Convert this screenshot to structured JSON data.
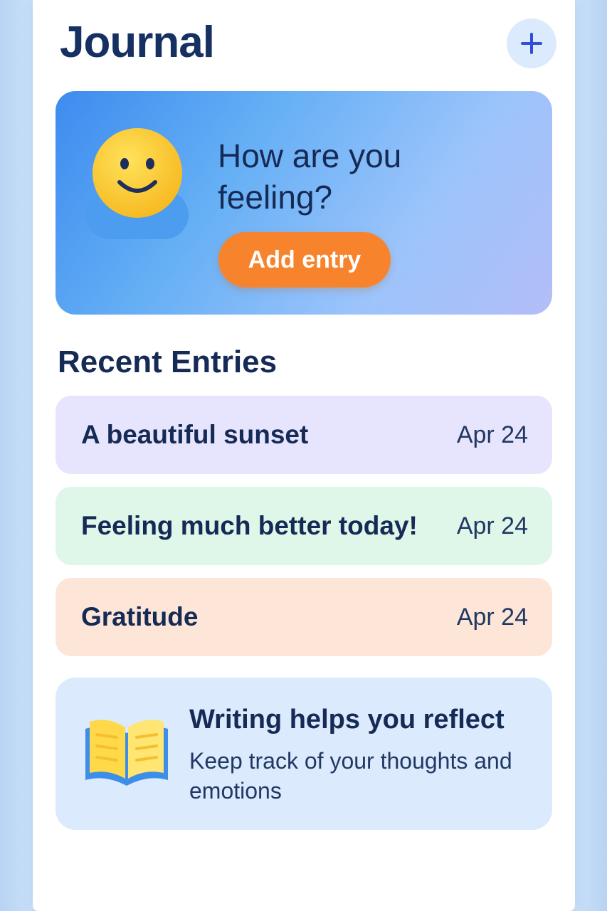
{
  "header": {
    "title": "Journal",
    "add_icon": "plus-icon"
  },
  "hero": {
    "icon": "smiley-face-icon",
    "question": "How are you feeling?",
    "button_label": "Add entry"
  },
  "recent": {
    "title": "Recent Entries",
    "entries": [
      {
        "title": "A beautiful sunset",
        "date": "Apr 24",
        "color": "#e7e5fd"
      },
      {
        "title": "Feeling much better today!",
        "date": "Apr 24",
        "color": "#dff7e9"
      },
      {
        "title": "Gratitude",
        "date": "Apr 24",
        "color": "#fde6d7"
      }
    ]
  },
  "tip": {
    "icon": "open-book-icon",
    "title": "Writing helps you reflect",
    "text": "Keep track of your thoughts and emotions"
  },
  "colors": {
    "accent": "#f7842c",
    "primary_text": "#152a55",
    "add_button": "#2f4fd8"
  }
}
